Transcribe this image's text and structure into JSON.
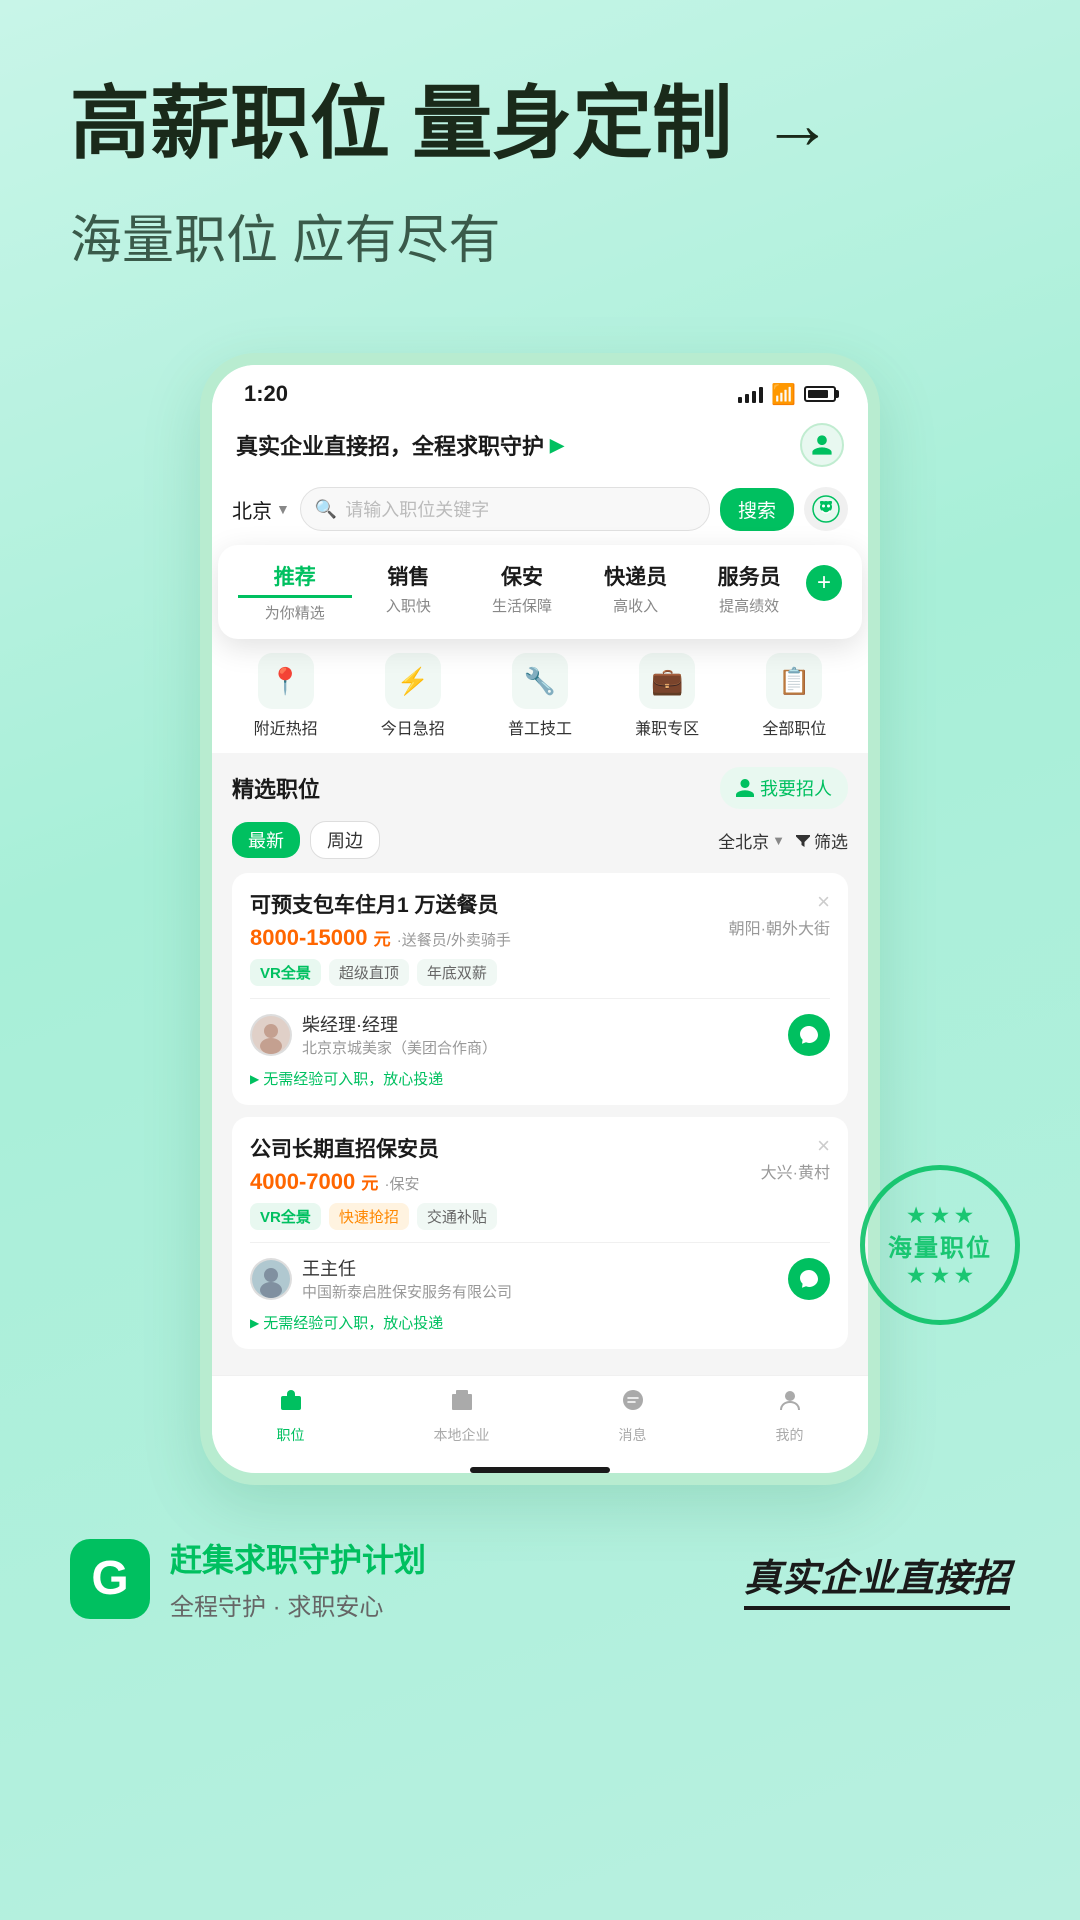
{
  "header": {
    "main_title": "高薪职位 量身定制",
    "sub_title": "海量职位 应有尽有",
    "arrow": "→"
  },
  "phone": {
    "status_bar": {
      "time": "1:20"
    },
    "app_header": {
      "text": "真实企业直接招，全程求职守护",
      "arrow": "▶"
    },
    "search": {
      "location": "北京",
      "placeholder": "请输入职位关键字",
      "button": "搜索"
    },
    "category_tabs": [
      {
        "label": "推荐",
        "sub": "为你精选",
        "active": true
      },
      {
        "label": "销售",
        "sub": "入职快",
        "active": false
      },
      {
        "label": "保安",
        "sub": "生活保障",
        "active": false
      },
      {
        "label": "快递员",
        "sub": "高收入",
        "active": false
      },
      {
        "label": "服务员",
        "sub": "提高绩效",
        "active": false
      }
    ],
    "icon_grid": [
      {
        "icon": "📍",
        "label": "附近热招"
      },
      {
        "icon": "⚡",
        "label": "今日急招"
      },
      {
        "icon": "🔧",
        "label": "普工技工"
      },
      {
        "icon": "💼",
        "label": "兼职专区"
      },
      {
        "icon": "📋",
        "label": "全部职位"
      }
    ],
    "jobs_section": {
      "title": "精选职位",
      "hire_button": "我要招人",
      "filter_tags": [
        "最新",
        "周边"
      ],
      "location_filter": "全北京",
      "filter_label": "筛选"
    },
    "job_cards": [
      {
        "title": "可预支包车住月1 万送餐员",
        "salary": "8000-15000",
        "salary_unit": "元",
        "salary_note": "·送餐员/外卖骑手",
        "location": "朝阳·朝外大街",
        "tags": [
          "VR全景",
          "超级直顶",
          "年底双薪"
        ],
        "tag_types": [
          "vr",
          "normal",
          "normal"
        ],
        "recruiter_name": "柴经理·经理",
        "company": "北京京城美家（美团合作商）",
        "no_exp_text": "无需经验可入职，放心投递"
      },
      {
        "title": "公司长期直招保安员",
        "salary": "4000-7000",
        "salary_unit": "元",
        "salary_note": "·保安",
        "location": "大兴·黄村",
        "tags": [
          "VR全景",
          "快速抢招",
          "交通补贴"
        ],
        "tag_types": [
          "vr",
          "orange",
          "normal"
        ],
        "recruiter_name": "王主任",
        "company": "中国新泰启胜保安服务有限公司",
        "no_exp_text": "无需经验可入职，放心投递"
      }
    ],
    "bottom_nav": [
      {
        "icon": "💼",
        "label": "职位",
        "active": true
      },
      {
        "icon": "🏢",
        "label": "本地企业",
        "active": false
      },
      {
        "icon": "💬",
        "label": "消息",
        "active": false
      },
      {
        "icon": "👤",
        "label": "我的",
        "active": false
      }
    ]
  },
  "stamp": {
    "text": "海量职位",
    "stars": [
      "★",
      "★",
      "★",
      "★",
      "★"
    ]
  },
  "footer": {
    "logo_text": "G",
    "brand": "赶集求职守护计划",
    "sub": "全程守护 · 求职安心",
    "slogan": "真实企业直接招"
  }
}
